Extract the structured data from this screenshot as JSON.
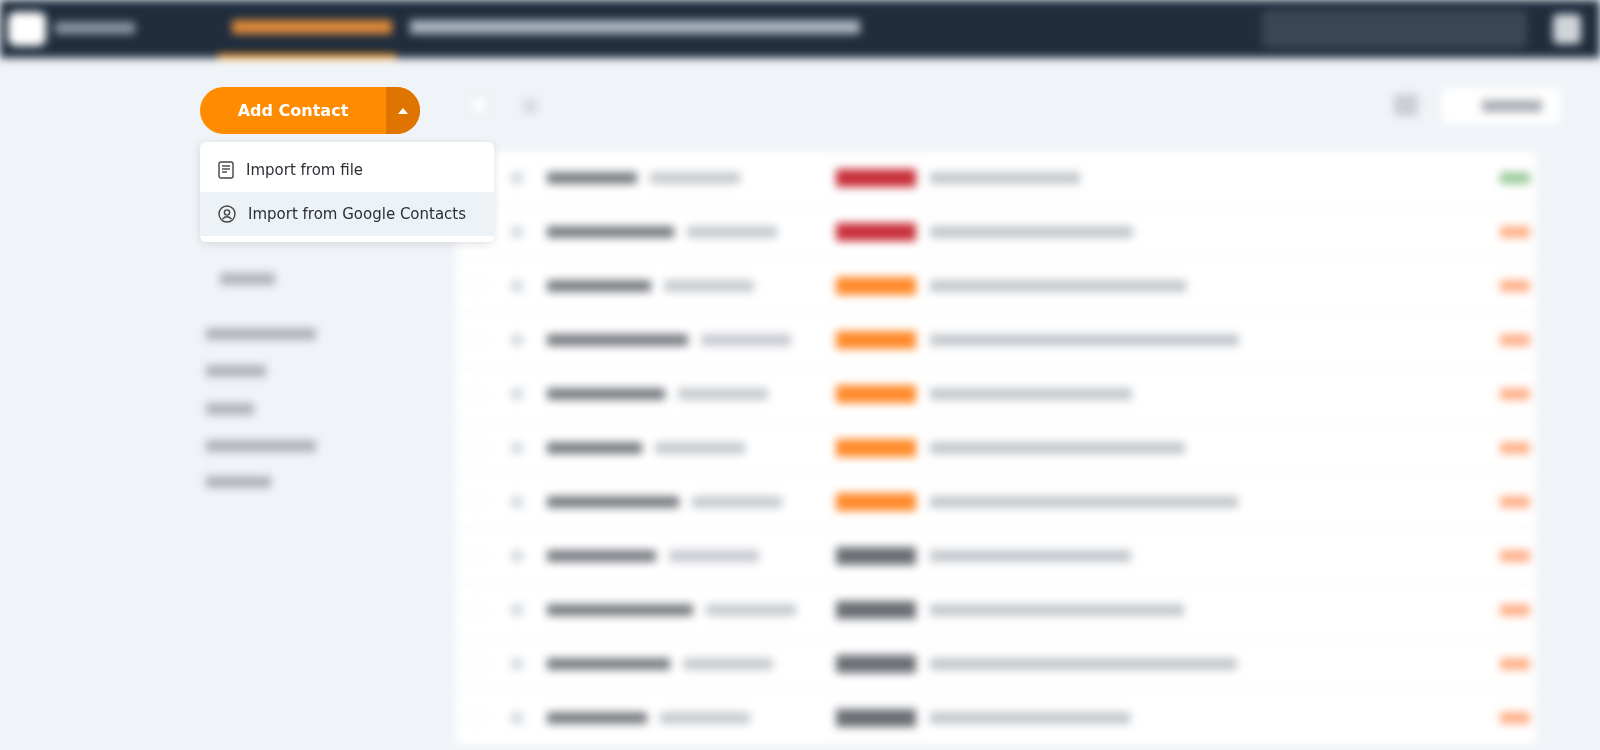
{
  "select_all": {
    "checked": false
  },
  "add_button": {
    "label": "Add Contact",
    "menu_open": true
  },
  "menu": {
    "items": [
      {
        "label": "Import from file",
        "kind": "file",
        "selected": false
      },
      {
        "label": "Import from Google Contacts",
        "kind": "person",
        "selected": true
      }
    ]
  }
}
